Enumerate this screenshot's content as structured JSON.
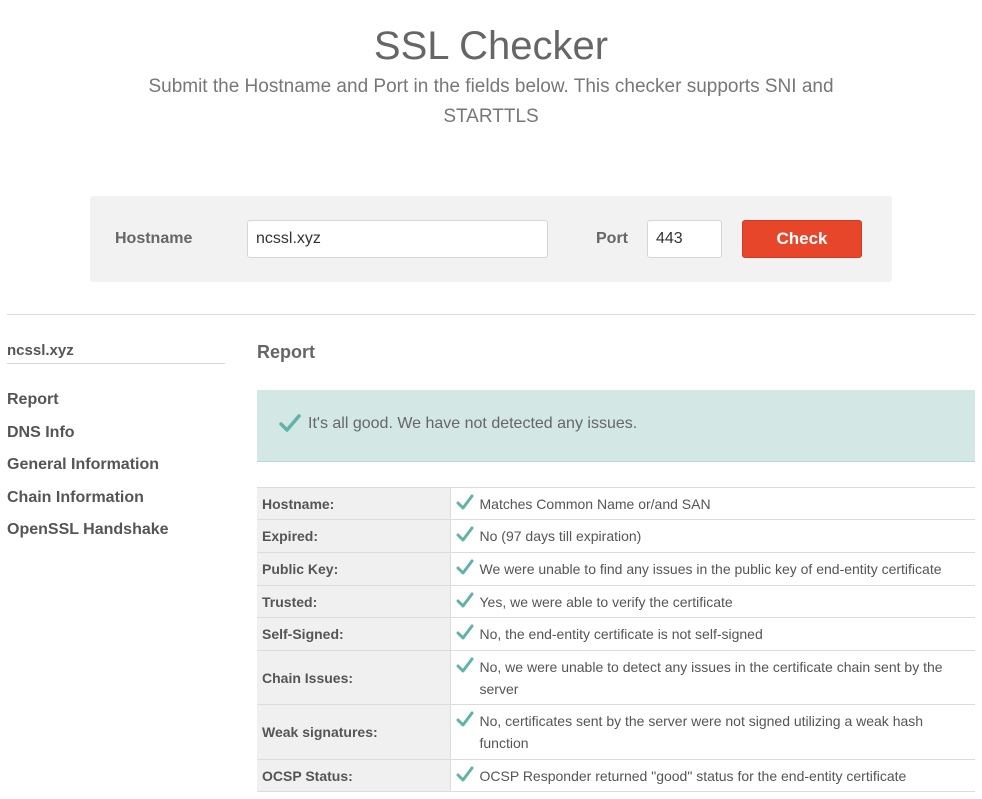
{
  "page": {
    "title": "SSL Checker",
    "subtitle": "Submit the Hostname and Port in the fields below. This checker supports SNI and STARTTLS"
  },
  "form": {
    "hostname_label": "Hostname",
    "hostname_value": "ncssl.xyz",
    "port_label": "Port",
    "port_value": "443",
    "check_label": "Check"
  },
  "sidebar": {
    "host": "ncssl.xyz",
    "items": [
      {
        "label": "Report"
      },
      {
        "label": "DNS Info"
      },
      {
        "label": "General Information"
      },
      {
        "label": "Chain Information"
      },
      {
        "label": "OpenSSL Handshake"
      }
    ]
  },
  "report": {
    "heading": "Report",
    "banner_text": "It's all good. We have not detected any issues.",
    "rows": [
      {
        "key": "Hostname:",
        "value": "Matches Common Name or/and SAN"
      },
      {
        "key": "Expired:",
        "value": "No (97 days till expiration)"
      },
      {
        "key": "Public Key:",
        "value": "We were unable to find any issues in the public key of end-entity certificate"
      },
      {
        "key": "Trusted:",
        "value": "Yes, we were able to verify the certificate"
      },
      {
        "key": "Self-Signed:",
        "value": "No, the end-entity certificate is not self-signed"
      },
      {
        "key": "Chain Issues:",
        "value": "No, we were unable to detect any issues in the certificate chain sent by the server"
      },
      {
        "key": "Weak signatures:",
        "value": "No, certificates sent by the server were not signed utilizing a weak hash function"
      },
      {
        "key": "OCSP Status:",
        "value": "OCSP Responder returned \"good\" status for the end-entity certificate"
      }
    ]
  },
  "colors": {
    "accent": "#e8462b",
    "success_bg": "#d3e7e5",
    "check_icon": "#5fb3a9"
  },
  "icons": {
    "banner": "check-icon",
    "row": "check-icon"
  }
}
